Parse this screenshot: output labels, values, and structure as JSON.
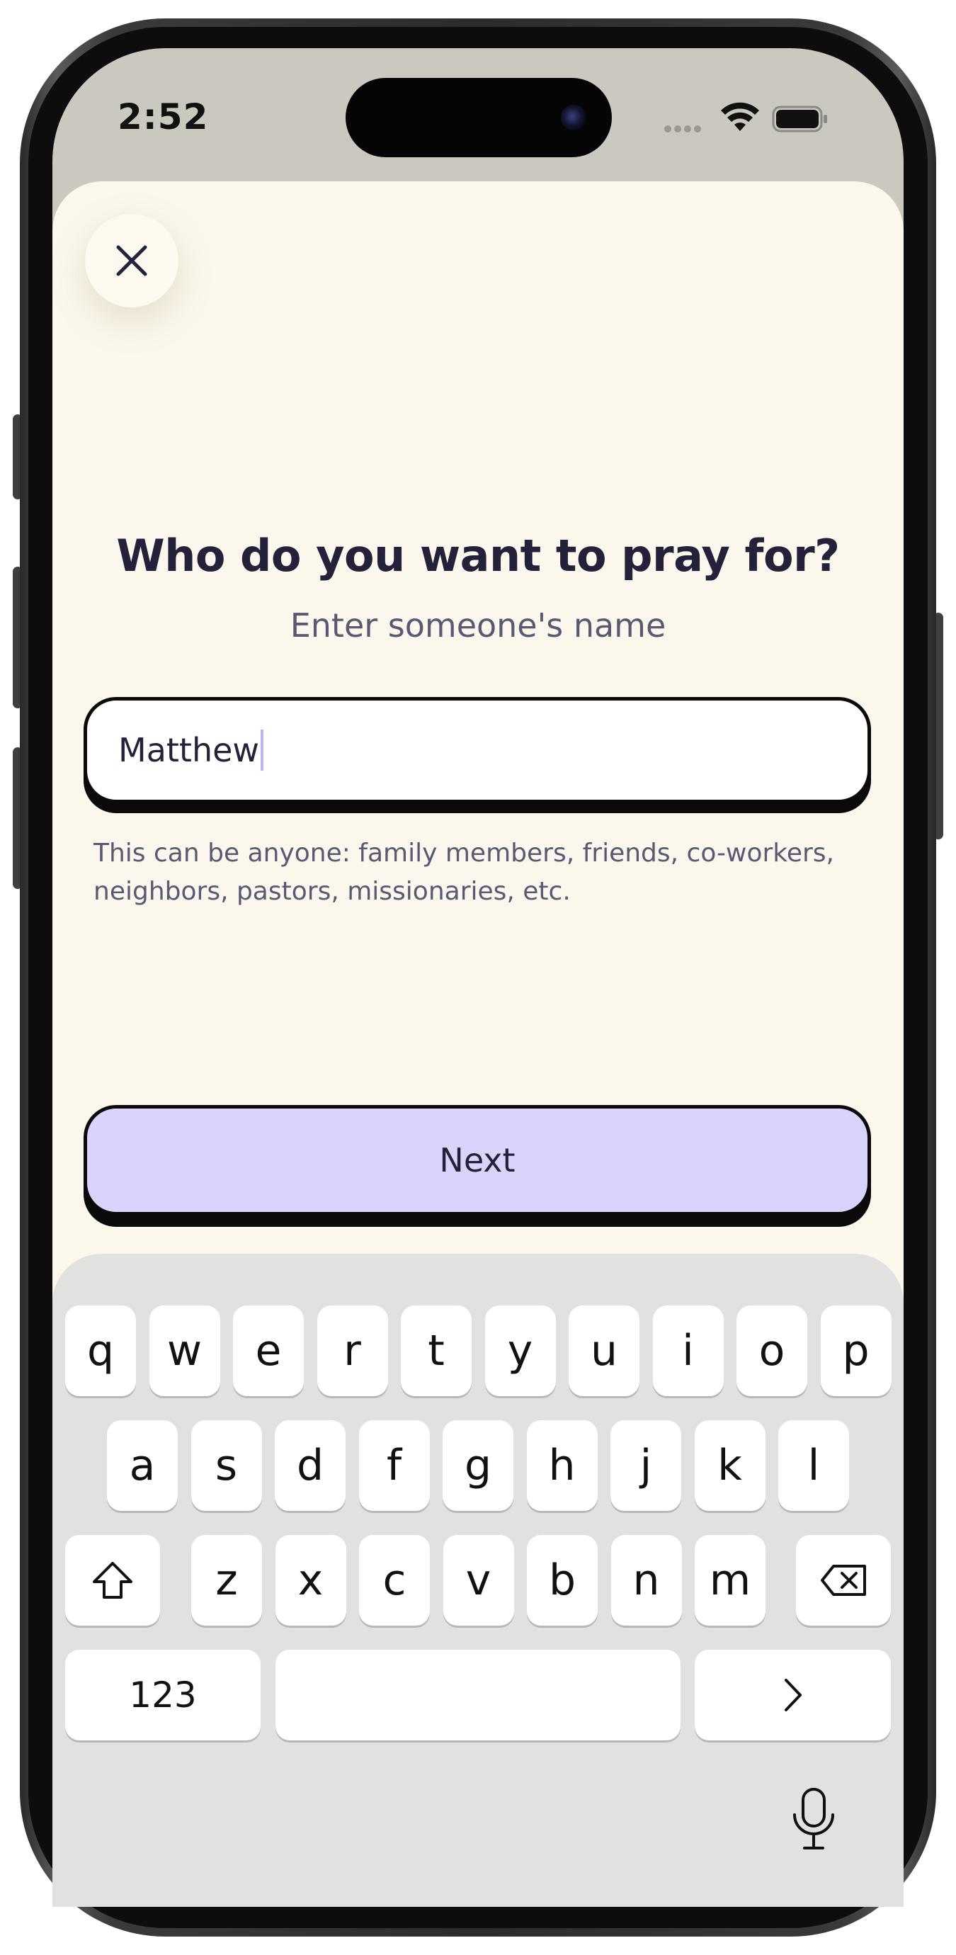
{
  "status_bar": {
    "time": "2:52",
    "icons": [
      "cellular-signal-icon",
      "wifi-icon",
      "battery-icon"
    ]
  },
  "sheet": {
    "close_icon": "close-icon",
    "title": "Who do you want to pray for?",
    "subtitle": "Enter someone's name",
    "name_input": {
      "value": "Matthew",
      "has_focus": true
    },
    "helper_text_line1": "This can be anyone: family members, friends, co-workers,",
    "helper_text_line2": "neighbors, pastors, missionaries, etc.",
    "next_button": "Next"
  },
  "keyboard": {
    "row1": [
      "q",
      "w",
      "e",
      "r",
      "t",
      "y",
      "u",
      "i",
      "o",
      "p"
    ],
    "row2": [
      "a",
      "s",
      "d",
      "f",
      "g",
      "h",
      "j",
      "k",
      "l"
    ],
    "row3": [
      "z",
      "x",
      "c",
      "v",
      "b",
      "n",
      "m"
    ],
    "numbers_key": "123",
    "return_key_icon": "chevron-right-icon",
    "shift_key_icon": "shift-icon",
    "delete_key_icon": "backspace-icon",
    "dictation_icon": "microphone-icon"
  },
  "colors": {
    "sheet_background": "#fbf7ec",
    "status_background": "#cbc8c0",
    "text_primary": "#24223a",
    "text_secondary": "#5b5874",
    "button_background": "#d8d4fb",
    "input_caret": "#bdb6ef",
    "keyboard_background": "#e2e1df"
  }
}
